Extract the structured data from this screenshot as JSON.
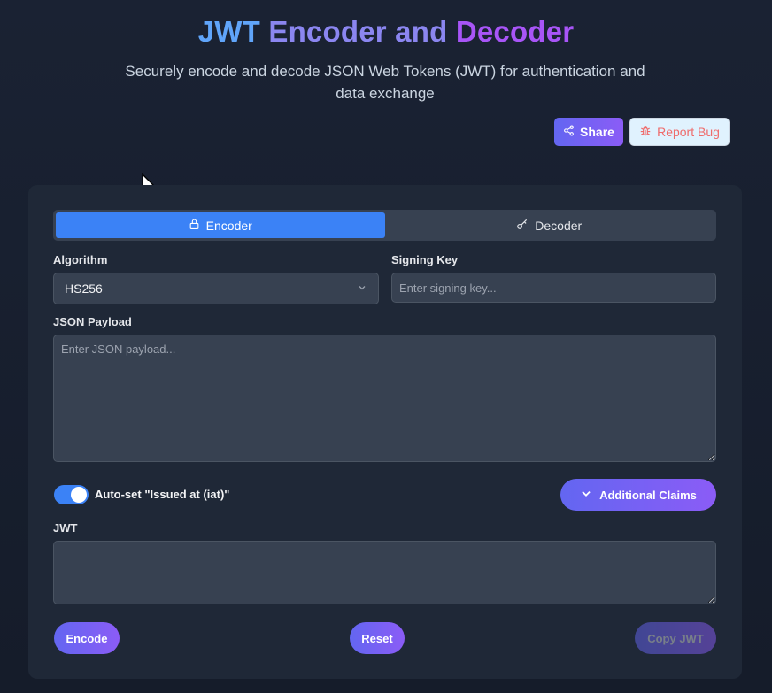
{
  "header": {
    "title_part1": "JWT",
    "title_part2": "Encoder and",
    "title_part3": "Decoder",
    "subtitle": "Securely encode and decode JSON Web Tokens (JWT) for authentication and data exchange",
    "share_label": "Share",
    "report_bug_label": "Report Bug"
  },
  "tabs": [
    {
      "label": "Encoder",
      "active": true,
      "icon": "lock-icon"
    },
    {
      "label": "Decoder",
      "active": false,
      "icon": "key-icon"
    }
  ],
  "form": {
    "algorithm_label": "Algorithm",
    "algorithm_value": "HS256",
    "signing_key_label": "Signing Key",
    "signing_key_placeholder": "Enter signing key...",
    "payload_label": "JSON Payload",
    "payload_placeholder": "Enter JSON payload...",
    "auto_iat_label": "Auto-set \"Issued at (iat)\"",
    "auto_iat_enabled": true,
    "additional_claims_label": "Additional Claims",
    "jwt_label": "JWT",
    "jwt_value": ""
  },
  "actions": {
    "encode_label": "Encode",
    "reset_label": "Reset",
    "copy_label": "Copy JWT"
  },
  "colors": {
    "accent": "#3b82f6",
    "gradient_start": "#6366f1",
    "gradient_end": "#8b5cf6",
    "background": "#1a2233",
    "card": "#1f2837"
  }
}
